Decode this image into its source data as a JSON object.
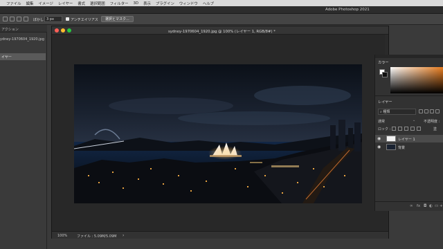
{
  "menubar": {
    "items": [
      "ファイル",
      "編集",
      "イメージ",
      "レイヤー",
      "書式",
      "選択範囲",
      "フィルター",
      "3D",
      "表示",
      "プラグイン",
      "ウィンドウ",
      "ヘルプ"
    ]
  },
  "app": {
    "title": "Adobe Photoshop 2021"
  },
  "options": {
    "feather_label": "ぼかし :",
    "feather_value": "3 px",
    "antialias_label": "アンチエイリアス",
    "antialias_checked": true,
    "select_mask_label": "選択とマスク..."
  },
  "left_panel": {
    "tab_label": "アクション",
    "doc_name": "ydney-1970604_1920.jpg",
    "layer_item": "イヤー"
  },
  "document": {
    "title": "sydney-1970604_1920.jpg @ 100% (レイヤー 1, RGB/8#) *",
    "zoom": "100%",
    "file_info": "ファイル : 5.09M/5.09M"
  },
  "color_panel": {
    "title": "カラー",
    "fg": "#ffffff",
    "bg": "#111111"
  },
  "layers_panel": {
    "title": "レイヤー",
    "filter_placeholder": "種類",
    "blend_mode": "通常",
    "opacity_label": "不透明度 :",
    "lock_label": "ロック :",
    "fill_label": "塗",
    "layers": [
      {
        "name": "レイヤー 1",
        "visible": true,
        "selected": true
      },
      {
        "name": "背景",
        "visible": true,
        "selected": false
      }
    ]
  }
}
